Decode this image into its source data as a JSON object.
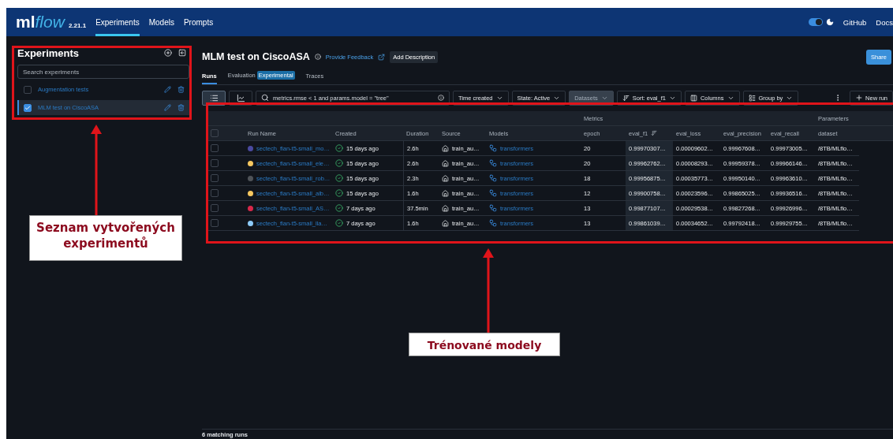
{
  "topbar": {
    "logo_main": "ml",
    "logo_flow": "flow",
    "version": "2.21.1",
    "nav": [
      {
        "label": "Experiments",
        "selected": true
      },
      {
        "label": "Models",
        "selected": false
      },
      {
        "label": "Prompts",
        "selected": false
      }
    ],
    "dark_mode": true,
    "links": [
      "GitHub",
      "Docs"
    ]
  },
  "sidebar": {
    "title": "Experiments",
    "search_placeholder": "Search experiments",
    "experiments": [
      {
        "label": "Augmentation tests",
        "checked": false,
        "selected": false
      },
      {
        "label": "MLM test on CiscoASA",
        "checked": true,
        "selected": true
      }
    ]
  },
  "header": {
    "title": "MLM test on CiscoASA",
    "feedback": "Provide Feedback",
    "add_description": "Add Description",
    "share": "Share"
  },
  "tabs": [
    {
      "label": "Runs",
      "selected": true
    },
    {
      "label": "Evaluation",
      "badge": "Experimental",
      "selected": false
    },
    {
      "label": "Traces",
      "selected": false
    }
  ],
  "toolbar": {
    "views": [
      {
        "kind": "list",
        "selected": true
      },
      {
        "kind": "chart",
        "selected": false
      }
    ],
    "search_value": "metrics.rmse < 1 and params.model = \"tree\"",
    "filters": [
      {
        "kind": "dropdown",
        "label": "Time created",
        "disabled": false
      },
      {
        "kind": "dropdown",
        "label": "State: Active",
        "disabled": false
      },
      {
        "kind": "dropdown",
        "label": "Datasets",
        "disabled": true
      },
      {
        "kind": "sort",
        "label": "Sort: eval_f1",
        "disabled": false
      },
      {
        "kind": "columns",
        "label": "Columns",
        "disabled": false
      },
      {
        "kind": "group",
        "label": "Group by",
        "disabled": false
      }
    ],
    "new_run": "New run"
  },
  "table": {
    "groups": [
      {
        "label": "Metrics"
      },
      {
        "label": "Parameters"
      }
    ],
    "all_selected": false,
    "columns": [
      {
        "label": "Run Name",
        "sorted": false
      },
      {
        "label": "Created",
        "sorted": false
      },
      {
        "label": "Duration",
        "sorted": false
      },
      {
        "label": "Source",
        "sorted": false
      },
      {
        "label": "Models",
        "sorted": false
      },
      {
        "label": "epoch",
        "sorted": false
      },
      {
        "label": "eval_f1",
        "sorted": true
      },
      {
        "label": "eval_loss",
        "sorted": false
      },
      {
        "label": "eval_precision",
        "sorted": false
      },
      {
        "label": "eval_recall",
        "sorted": false
      },
      {
        "label": "dataset",
        "sorted": false
      }
    ],
    "rows": [
      {
        "selected": false,
        "color": "#4b4aa0",
        "name": "sectech_flan-t5-small_mo…",
        "created": "15 days ago",
        "duration": "2.6h",
        "source": "train_au…",
        "model": "transformers",
        "values": [
          "20",
          "0.99970307…",
          "0.00009602…",
          "0.99967608…",
          "0.99973005…",
          "/8TB/MLflo…"
        ]
      },
      {
        "selected": false,
        "color": "#f7c860",
        "name": "sectech_flan-t5-small_ele…",
        "created": "15 days ago",
        "duration": "2.6h",
        "source": "train_au…",
        "model": "transformers",
        "values": [
          "20",
          "0.99962762…",
          "0.00008293…",
          "0.99959378…",
          "0.99966146…",
          "/8TB/MLflo…"
        ]
      },
      {
        "selected": false,
        "color": "#4f5358",
        "name": "sectech_flan-t5-small_rob…",
        "created": "15 days ago",
        "duration": "2.3h",
        "source": "train_au…",
        "model": "transformers",
        "values": [
          "18",
          "0.99956875…",
          "0.00035773…",
          "0.99950140…",
          "0.99963610…",
          "/8TB/MLflo…"
        ]
      },
      {
        "selected": false,
        "color": "#f7c860",
        "name": "sectech_flan-t5-small_alb…",
        "created": "15 days ago",
        "duration": "1.6h",
        "source": "train_au…",
        "model": "transformers",
        "values": [
          "12",
          "0.99900758…",
          "0.00023596…",
          "0.99865025…",
          "0.99936516…",
          "/8TB/MLflo…"
        ]
      },
      {
        "selected": false,
        "color": "#d7284a",
        "name": "sectech_flan-t5-small_AS…",
        "created": "7 days ago",
        "duration": "37.5min",
        "source": "train_au…",
        "model": "transformers",
        "values": [
          "13",
          "0.99877107…",
          "0.00029538…",
          "0.99827268…",
          "0.99926996…",
          "/8TB/MLflo…"
        ]
      },
      {
        "selected": false,
        "color": "#8ecbf8",
        "name": "sectech_flan-t5-small_lla…",
        "created": "7 days ago",
        "duration": "1.6h",
        "source": "train_au…",
        "model": "transformers",
        "values": [
          "13",
          "0.99861039…",
          "0.00034652…",
          "0.99792418…",
          "0.99929755…",
          "/8TB/MLflo…"
        ]
      }
    ]
  },
  "footer": "6 matching runs",
  "annotations": [
    {
      "label": "Seznam vytvořených experimentů"
    },
    {
      "label": "Trénované modely"
    }
  ]
}
